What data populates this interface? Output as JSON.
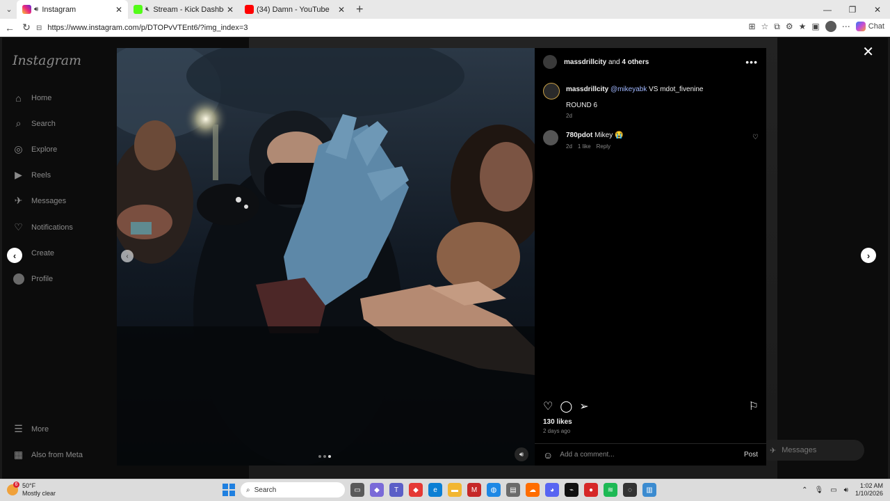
{
  "browser": {
    "tabs": [
      {
        "title": "Instagram",
        "favicon_color": "#d6249f",
        "active": true
      },
      {
        "title": "Stream - Kick Dashboard",
        "favicon_color": "#53fc18",
        "active": false
      },
      {
        "title": "(34) Damn - YouTube",
        "favicon_color": "#ff0000",
        "active": false
      }
    ],
    "url": "https://www.instagram.com/p/DTOPvVTEnt6/?img_index=3",
    "chat_label": "Chat"
  },
  "instagram": {
    "logo": "Instagram",
    "nav": [
      {
        "label": "Home",
        "icon": "home-icon",
        "glyph": "⌂"
      },
      {
        "label": "Search",
        "icon": "search-icon",
        "glyph": "⌕"
      },
      {
        "label": "Explore",
        "icon": "compass-icon",
        "glyph": "◎"
      },
      {
        "label": "Reels",
        "icon": "reels-icon",
        "glyph": "▶"
      },
      {
        "label": "Messages",
        "icon": "messages-icon",
        "glyph": "✈"
      },
      {
        "label": "Notifications",
        "icon": "heart-icon",
        "glyph": "♡"
      },
      {
        "label": "Create",
        "icon": "plus-icon",
        "glyph": "⊕"
      },
      {
        "label": "Profile",
        "icon": "avatar",
        "glyph": ""
      }
    ],
    "more": "More",
    "also_from_meta": "Also from Meta",
    "messages_pill": "Messages"
  },
  "post": {
    "header_user": "massdrillcity",
    "header_rest": "and",
    "header_others": "4 others",
    "caption_user": "massdrillcity",
    "caption_mention": "@mikeyabk",
    "caption_rest": "VS mdot_fivenine",
    "caption_line2": "ROUND 6",
    "caption_time": "2d",
    "comment_user": "780pdot",
    "comment_text": "Mikey 😭",
    "comment_time": "2d",
    "comment_likes": "1 like",
    "comment_reply": "Reply",
    "likes": "130 likes",
    "posted": "2 days ago",
    "comment_placeholder": "Add a comment...",
    "post_button": "Post",
    "carousel_total": 3,
    "carousel_active": 3
  },
  "taskbar": {
    "weather_temp": "50°F",
    "weather_desc": "Mostly clear",
    "weather_badge": "6",
    "search_label": "Search",
    "time": "1:02 AM",
    "date": "1/10/2026"
  }
}
